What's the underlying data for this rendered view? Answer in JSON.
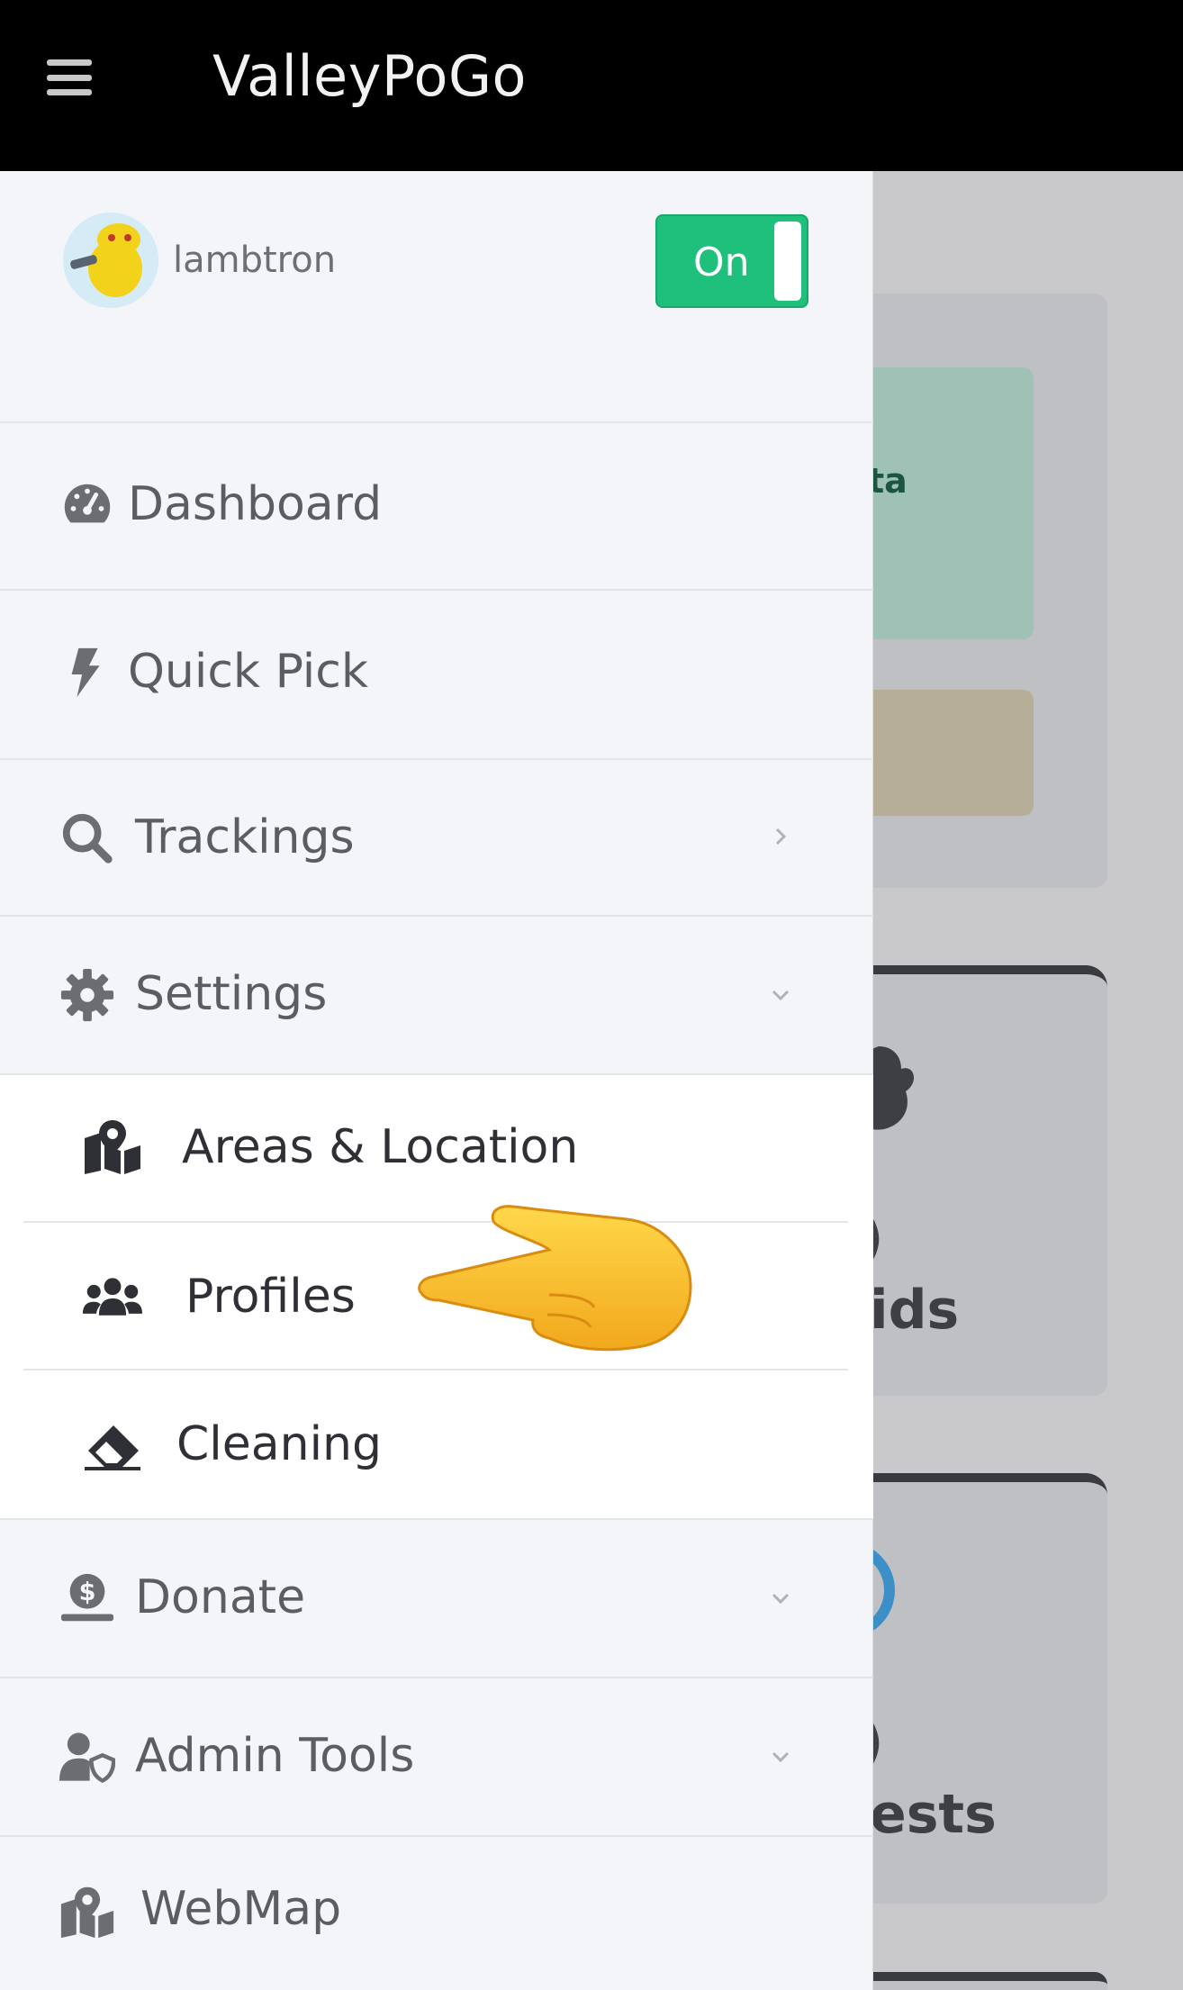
{
  "header": {
    "menu_icon": "hamburger-menu-icon",
    "title": "ValleyPoGo"
  },
  "user": {
    "name": "lambtron",
    "avatar_icon": "user-avatar",
    "toggle_label": "On",
    "toggle_state": true,
    "toggle_color": "#1fc07b"
  },
  "menu": {
    "dashboard": {
      "label": "Dashboard",
      "icon": "tachometer-icon"
    },
    "quick_pick": {
      "label": "Quick Pick",
      "icon": "bolt-icon"
    },
    "trackings": {
      "label": "Trackings",
      "icon": "search-icon",
      "chevron": "chevron-right-icon"
    },
    "settings": {
      "label": "Settings",
      "icon": "gear-icon",
      "chevron": "chevron-down-icon",
      "children": {
        "areas": {
          "label": "Areas & Location",
          "icon": "map-marked-icon"
        },
        "profiles": {
          "label": "Profiles",
          "icon": "users-icon"
        },
        "cleaning": {
          "label": "Cleaning",
          "icon": "eraser-icon"
        }
      }
    },
    "donate": {
      "label": "Donate",
      "icon": "hand-holding-dollar-icon",
      "chevron": "chevron-down-icon"
    },
    "admin_tools": {
      "label": "Admin Tools",
      "icon": "user-shield-icon",
      "chevron": "chevron-down-icon"
    },
    "webmap": {
      "label": "WebMap",
      "icon": "map-marked-icon"
    }
  },
  "background": {
    "fragment_1": "ta",
    "fragment_2": ")",
    "fragment_3": "ids",
    "fragment_4": ")",
    "fragment_5": "ests"
  },
  "overlay": {
    "pointer": "pointing-hand-emoji"
  }
}
